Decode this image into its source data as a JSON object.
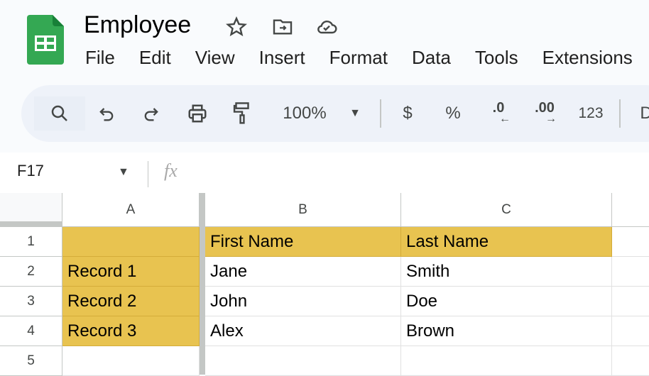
{
  "app": {
    "title": "Employee",
    "brand_color": "#34a853",
    "fill_color": "#e8c350"
  },
  "title_icons": [
    "star-icon",
    "move-to-folder-icon",
    "cloud-saved-icon"
  ],
  "menu": [
    "File",
    "Edit",
    "View",
    "Insert",
    "Format",
    "Data",
    "Tools",
    "Extensions"
  ],
  "toolbar": {
    "zoom": "100%",
    "currency": "$",
    "percent": "%",
    "decrease_decimal": ".0",
    "increase_decimal": ".00",
    "number_format": "123",
    "more": "D"
  },
  "formula_bar": {
    "name_box": "F17",
    "fx": "fx",
    "value": ""
  },
  "columns": [
    "A",
    "B",
    "C"
  ],
  "rows": [
    "1",
    "2",
    "3",
    "4",
    "5"
  ],
  "cells": [
    [
      "",
      "First Name",
      "Last Name"
    ],
    [
      "Record 1",
      "Jane",
      "Smith"
    ],
    [
      "Record 2",
      "John",
      "Doe"
    ],
    [
      "Record 3",
      "Alex",
      "Brown"
    ],
    [
      "",
      "",
      ""
    ]
  ]
}
